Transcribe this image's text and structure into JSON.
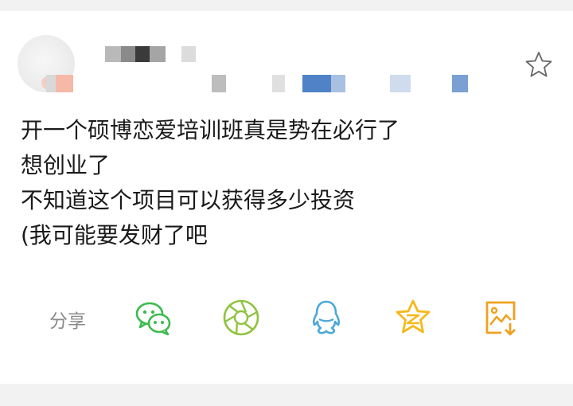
{
  "post": {
    "lines": [
      "开一个硕博恋爱培训班真是势在必行了",
      "想创业了",
      "不知道这个项目可以获得多少投资",
      "(我可能要发财了吧"
    ]
  },
  "share": {
    "label": "分享",
    "buttons": [
      {
        "name": "wechat-icon",
        "color": "#3dbb4f"
      },
      {
        "name": "moments-icon",
        "color": "#8fc43f"
      },
      {
        "name": "qq-icon",
        "color": "#4aa8d8"
      },
      {
        "name": "qzone-icon",
        "color": "#f5b81c"
      },
      {
        "name": "save-image-icon",
        "color": "#f0a020"
      }
    ]
  },
  "favorite": {
    "icon": "star-outline-icon"
  },
  "colors": {
    "background": "#f2f2f2",
    "card": "#ffffff",
    "text": "#1a1a1a",
    "muted": "#8a8a8a"
  }
}
